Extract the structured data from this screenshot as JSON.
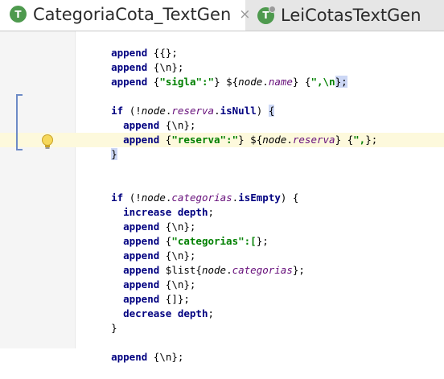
{
  "tabs": [
    {
      "label": "CategoriaCota_TextGen",
      "icon": "T",
      "active": true,
      "close": "×"
    },
    {
      "label": "LeiCotasTextGen",
      "icon": "T",
      "active": false
    }
  ],
  "code": {
    "l1": {
      "kw": "append",
      "rest": " {{};"
    },
    "l2": {
      "kw": "append",
      "rest": " {\\n};"
    },
    "l3": {
      "kw": "append",
      "a": " {",
      "s": "\"sigla\":\"",
      "b": "} ${",
      "node": "node",
      "dot": ".",
      "prop": "name",
      "c": "} {",
      "s2": "\",\\n",
      "d": "};"
    },
    "l4": {
      "kw": "if",
      "a": " (!",
      "node": "node",
      "dot": ".",
      "prop": "reserva",
      "dot2": ".",
      "m": "isNull",
      "b": ") ",
      "brace": "{"
    },
    "l5": {
      "kw": "append",
      "rest": " {\\n};"
    },
    "l6": {
      "kw": "append",
      "a": " {",
      "s": "\"reserva\":\"",
      "b": "} ${",
      "node": "node",
      "dot": ".",
      "prop": "reserva",
      "c": "} {",
      "s2": "\",",
      "d": "};"
    },
    "l7": {
      "brace": "}"
    },
    "l8": {
      "kw": "if",
      "a": " (!",
      "node": "node",
      "dot": ".",
      "prop": "categorias",
      "dot2": ".",
      "m": "isEmpty",
      "b": ") {"
    },
    "l9": {
      "kw": "increase depth",
      "rest": ";"
    },
    "l10": {
      "kw": "append",
      "rest": " {\\n};"
    },
    "l11": {
      "kw": "append",
      "a": " {",
      "s": "\"categorias\":[",
      "d": "};"
    },
    "l12": {
      "kw": "append",
      "rest": " {\\n};"
    },
    "l13": {
      "kw": "append",
      "a": " $list{",
      "node": "node",
      "dot": ".",
      "prop": "categorias",
      "d": "};"
    },
    "l14": {
      "kw": "append",
      "rest": " {\\n};"
    },
    "l15": {
      "kw": "append",
      "rest": " {]};"
    },
    "l16": {
      "kw": "decrease depth",
      "rest": ";"
    },
    "l17": {
      "brace": "}"
    },
    "l18": {
      "kw": "append",
      "rest": " {\\n};"
    }
  },
  "colors": {
    "keyword": "#000080",
    "string": "#008000",
    "property": "#660e7a",
    "highlight_line": "#fdf9dc"
  },
  "icons": {
    "intention": "lightbulb-icon",
    "tab_file": "textgen-file-icon"
  }
}
